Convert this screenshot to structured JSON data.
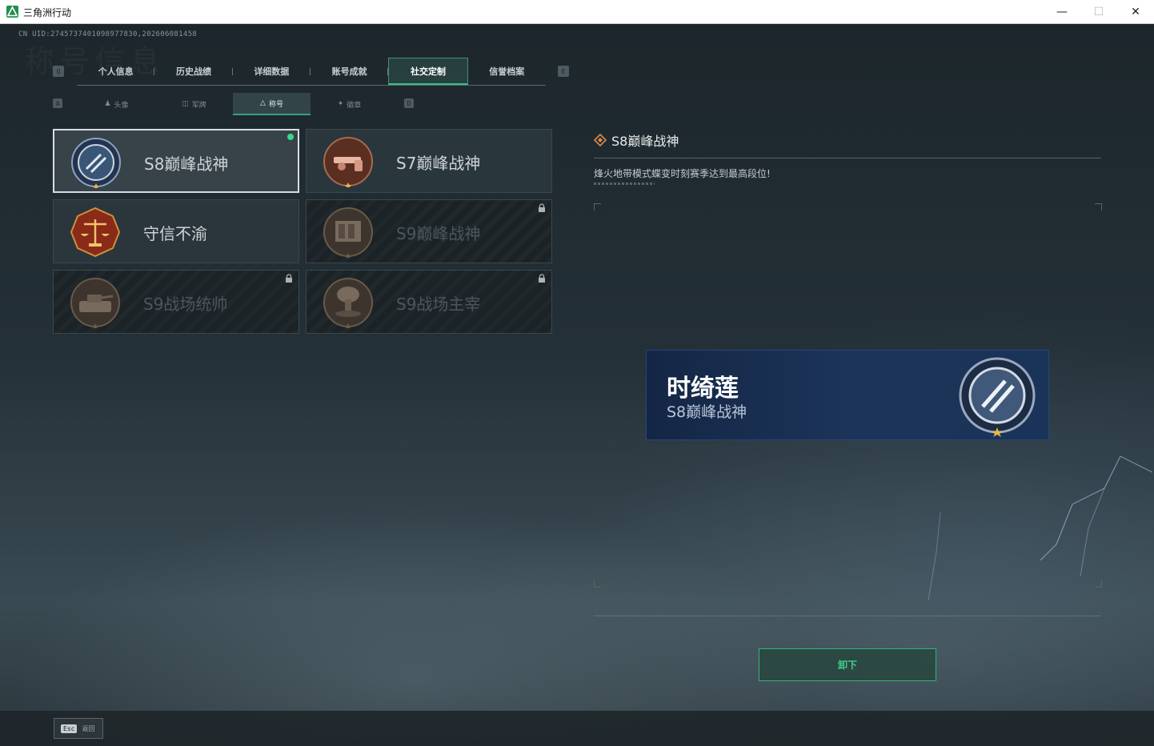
{
  "window": {
    "title": "三角洲行动",
    "minimize": "—",
    "maximize": "☐",
    "close": "✕"
  },
  "header": {
    "uid": "CN UID:2745737401098977830,202606081458",
    "watermark": "称号信息"
  },
  "main_tabs": {
    "left_key": "Q",
    "right_key": "E",
    "items": [
      {
        "label": "个人信息"
      },
      {
        "label": "历史战绩"
      },
      {
        "label": "详细数据"
      },
      {
        "label": "账号成就"
      },
      {
        "label": "社交定制",
        "active": true
      },
      {
        "label": "信誉档案"
      }
    ]
  },
  "sub_tabs": {
    "left_key": "A",
    "right_key": "D",
    "items": [
      {
        "label": "头像",
        "icon": "person-icon"
      },
      {
        "label": "军牌",
        "icon": "tag-icon"
      },
      {
        "label": "称号",
        "icon": "triangle-icon",
        "active": true
      },
      {
        "label": "徽章",
        "icon": "wing-icon"
      }
    ]
  },
  "titles": [
    {
      "name": "S8巅峰战神",
      "selected": true,
      "equipped": true,
      "locked": false,
      "medal": "s8-peak-medal"
    },
    {
      "name": "S7巅峰战神",
      "selected": false,
      "equipped": false,
      "locked": false,
      "medal": "s7-peak-medal"
    },
    {
      "name": "守信不渝",
      "selected": false,
      "equipped": false,
      "locked": false,
      "medal": "scales-medal"
    },
    {
      "name": "S9巅峰战神",
      "selected": false,
      "equipped": false,
      "locked": true,
      "medal": "s9-peak-medal"
    },
    {
      "name": "S9战场统帅",
      "selected": false,
      "equipped": false,
      "locked": true,
      "medal": "tank-medal"
    },
    {
      "name": "S9战场主宰",
      "selected": false,
      "equipped": false,
      "locked": true,
      "medal": "explosion-medal"
    }
  ],
  "detail": {
    "title": "S8巅峰战神",
    "description": "烽火地带模式蝶变时刻赛季达到最高段位!"
  },
  "nameplate": {
    "player_name": "时绮莲",
    "title": "S8巅峰战神"
  },
  "actions": {
    "unequip": "卸下"
  },
  "footer": {
    "esc_key": "Esc",
    "back": "返回"
  },
  "colors": {
    "accent_green": "#37c08a",
    "equipped_dot": "#3ad78a",
    "nameplate_blue": "#1c3459"
  }
}
